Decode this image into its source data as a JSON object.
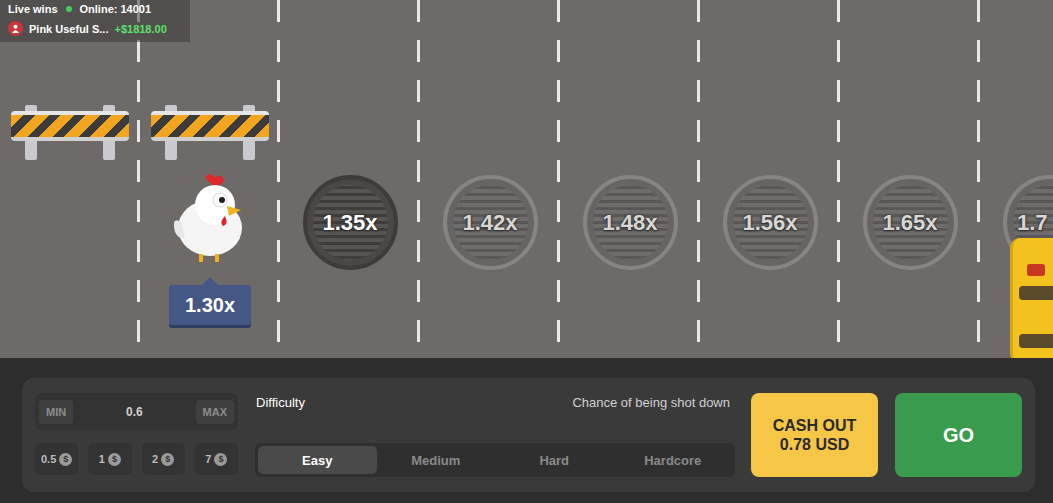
{
  "live_wins": {
    "title": "Live wins",
    "online": "Online: 14001",
    "wins": [
      {
        "name": "Pink Useful S...",
        "amount": "+$1818.00"
      }
    ]
  },
  "road": {
    "lanes": [
      {
        "kind": "empty",
        "barrier": true
      },
      {
        "kind": "chicken",
        "barrier": true,
        "multiplier": "1.30x"
      },
      {
        "kind": "cover",
        "barrier": false,
        "multiplier": "1.35x",
        "selected": true,
        "car": false
      },
      {
        "kind": "cover",
        "barrier": false,
        "multiplier": "1.42x",
        "selected": false,
        "car": false
      },
      {
        "kind": "cover",
        "barrier": false,
        "multiplier": "1.48x",
        "selected": false,
        "car": false
      },
      {
        "kind": "cover",
        "barrier": false,
        "multiplier": "1.56x",
        "selected": false,
        "car": false
      },
      {
        "kind": "cover",
        "barrier": false,
        "multiplier": "1.65x",
        "selected": false,
        "car": false
      },
      {
        "kind": "cover",
        "barrier": false,
        "multiplier": "1.7",
        "selected": false,
        "car": true
      }
    ]
  },
  "bet": {
    "min": "MIN",
    "value": "0.6",
    "max": "MAX",
    "chips": [
      {
        "label": "0.5",
        "symbol": "$"
      },
      {
        "label": "1",
        "symbol": "$"
      },
      {
        "label": "2",
        "symbol": "$"
      },
      {
        "label": "7",
        "symbol": "$"
      }
    ]
  },
  "difficulty": {
    "label": "Difficulty",
    "hint": "Chance of being shot down",
    "options": [
      {
        "label": "Easy",
        "selected": true
      },
      {
        "label": "Medium",
        "selected": false
      },
      {
        "label": "Hard",
        "selected": false
      },
      {
        "label": "Hardcore",
        "selected": false
      }
    ]
  },
  "cash_out": {
    "label": "CASH OUT",
    "amount": "0.78 USD"
  },
  "go": {
    "label": "GO"
  }
}
